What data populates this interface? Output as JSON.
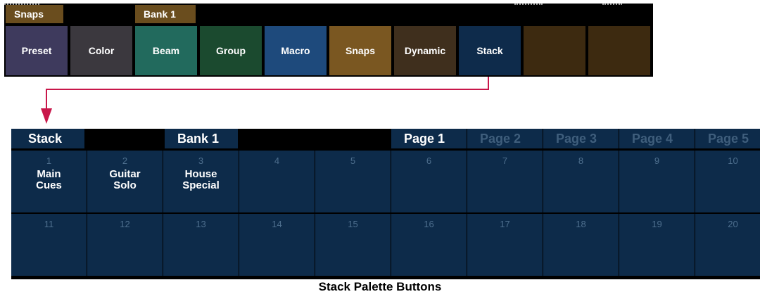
{
  "top_palette": {
    "left_tab": "Snaps",
    "bank_tab": "Bank 1",
    "buttons": [
      {
        "label": "Preset",
        "color": "#3e3a5d"
      },
      {
        "label": "Color",
        "color": "#3b383e"
      },
      {
        "label": "Beam",
        "color": "#226a5d"
      },
      {
        "label": "Group",
        "color": "#1b4a2f"
      },
      {
        "label": "Macro",
        "color": "#1e4a7c"
      },
      {
        "label": "Snaps",
        "color": "#7a5721"
      },
      {
        "label": "Dynamic",
        "color": "#3f2f1d"
      },
      {
        "label": "Stack",
        "color": "#0e2b4b"
      },
      {
        "label": "",
        "color": "#3d2a10"
      },
      {
        "label": "",
        "color": "#3d2a10"
      }
    ]
  },
  "connector_color": "#c8174a",
  "stack_palette": {
    "title": "Stack",
    "bank": "Bank 1",
    "pages": [
      "Page 1",
      "Page 2",
      "Page 3",
      "Page 4",
      "Page 5"
    ],
    "active_page": "Page 1",
    "cells": [
      {
        "num": "1",
        "label": [
          "Main",
          "Cues"
        ]
      },
      {
        "num": "2",
        "label": [
          "Guitar",
          "Solo"
        ]
      },
      {
        "num": "3",
        "label": [
          "House",
          "Special"
        ]
      },
      {
        "num": "4",
        "label": []
      },
      {
        "num": "5",
        "label": []
      },
      {
        "num": "6",
        "label": []
      },
      {
        "num": "7",
        "label": []
      },
      {
        "num": "8",
        "label": []
      },
      {
        "num": "9",
        "label": []
      },
      {
        "num": "10",
        "label": []
      },
      {
        "num": "11",
        "label": []
      },
      {
        "num": "12",
        "label": []
      },
      {
        "num": "13",
        "label": []
      },
      {
        "num": "14",
        "label": []
      },
      {
        "num": "15",
        "label": []
      },
      {
        "num": "16",
        "label": []
      },
      {
        "num": "17",
        "label": []
      },
      {
        "num": "18",
        "label": []
      },
      {
        "num": "19",
        "label": []
      },
      {
        "num": "20",
        "label": []
      }
    ]
  },
  "caption": "Stack Palette Buttons"
}
